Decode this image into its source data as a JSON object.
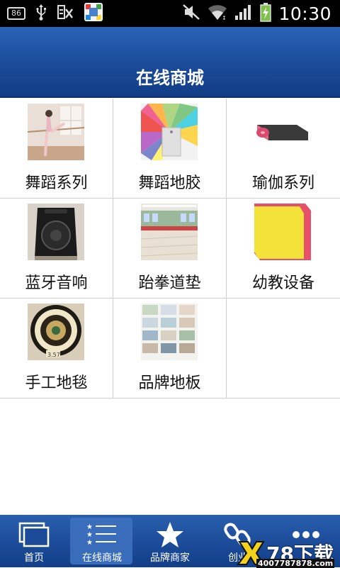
{
  "status_bar": {
    "battery_level": "86",
    "time": "10:30"
  },
  "header": {
    "title": "在线商城"
  },
  "grid": {
    "items": [
      {
        "label": "舞蹈系列"
      },
      {
        "label": "舞蹈地胶"
      },
      {
        "label": "瑜伽系列"
      },
      {
        "label": "蓝牙音响"
      },
      {
        "label": "跆拳道垫"
      },
      {
        "label": "幼教设备"
      },
      {
        "label": "手工地毯"
      },
      {
        "label": "品牌地板"
      }
    ]
  },
  "bottom_nav": {
    "items": [
      {
        "label": "首页",
        "icon": "pages-icon"
      },
      {
        "label": "在线商城",
        "icon": "list-icon"
      },
      {
        "label": "品牌商家",
        "icon": "star-icon"
      },
      {
        "label": "创业",
        "icon": "link-icon"
      },
      {
        "label": "",
        "icon": "more-icon"
      }
    ],
    "active_index": 1
  },
  "watermark": {
    "brand": "78下载",
    "phone": "4007787878.com"
  },
  "colors": {
    "header": "#1c4f9e",
    "nav": "#1a4a98",
    "grid_line": "#cfcfcf"
  }
}
